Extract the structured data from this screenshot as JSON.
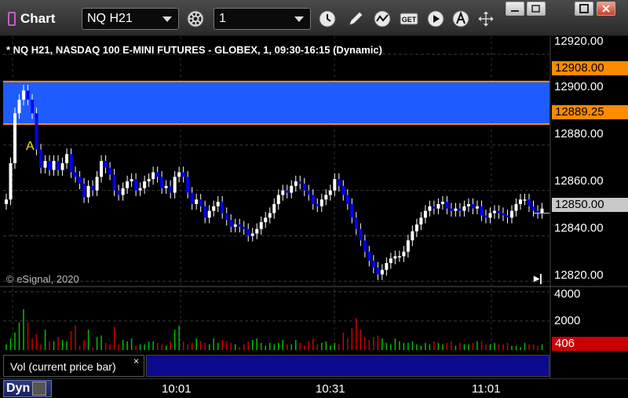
{
  "window": {
    "title": "Chart"
  },
  "toolbar": {
    "symbol": "NQ H21",
    "interval": "1",
    "icons": [
      "settings-icon",
      "clock-icon",
      "pen-icon",
      "study-icon",
      "get-icon",
      "play-icon",
      "alert-icon",
      "cursor-icon"
    ],
    "get_label": "GET",
    "window_controls": [
      "minimize",
      "restore",
      "maximize",
      "close"
    ]
  },
  "chart": {
    "header": "* NQ H21, NASDAQ 100 E-MINI FUTURES - GLOBEX, 1, 09:30-16:15 (Dynamic)",
    "copyright": "© eSignal, 2020",
    "annotation": "A",
    "scroll_end_label": "▸|",
    "price_axis": [
      "12920.00",
      "12900.00",
      "12880.00",
      "12860.00",
      "12840.00",
      "12820.00"
    ],
    "band_upper": "12908.00",
    "band_lower": "12889.25",
    "last_price": "12850.00",
    "colors": {
      "up": "#ffffff",
      "down": "#0000ff",
      "band": "#1e5cff",
      "band_line": "#ff8a00",
      "last": "#c8c8c8"
    }
  },
  "volume": {
    "pane_label": "Vol (current price bar)",
    "close": "×",
    "axis": [
      "4000",
      "2000",
      "0"
    ],
    "last": "406",
    "last_color": "#cc0000"
  },
  "bottom": {
    "mode": "Dyn",
    "times": [
      "10:01",
      "10:31",
      "11:01"
    ]
  },
  "chart_data": {
    "type": "candlestick",
    "symbol": "NQ H21",
    "interval": "1",
    "ylim": [
      12818,
      12928
    ],
    "closes": [
      12856,
      12872,
      12894,
      12900,
      12904,
      12900,
      12894,
      12878,
      12870,
      12873,
      12869,
      12873,
      12869,
      12872,
      12876,
      12868,
      12866,
      12863,
      12857,
      12862,
      12860,
      12866,
      12873,
      12870,
      12867,
      12860,
      12858,
      12861,
      12864,
      12865,
      12860,
      12861,
      12864,
      12865,
      12868,
      12866,
      12861,
      12862,
      12859,
      12866,
      12868,
      12866,
      12859,
      12854,
      12856,
      12853,
      12848,
      12851,
      12853,
      12855,
      12850,
      12847,
      12844,
      12845,
      12844,
      12843,
      12840,
      12841,
      12843,
      12846,
      12848,
      12850,
      12854,
      12858,
      12860,
      12859,
      12862,
      12864,
      12863,
      12860,
      12858,
      12854,
      12853,
      12856,
      12858,
      12860,
      12865,
      12862,
      12858,
      12854,
      12848,
      12843,
      12838,
      12833,
      12829,
      12826,
      12823,
      12825,
      12828,
      12830,
      12831,
      12831,
      12833,
      12838,
      12842,
      12845,
      12848,
      12851,
      12853,
      12852,
      12854,
      12855,
      12852,
      12851,
      12852,
      12851,
      12853,
      12854,
      12852,
      12853,
      12849,
      12848,
      12850,
      12851,
      12850,
      12849,
      12848,
      12851,
      12854,
      12856,
      12856,
      12853,
      12851,
      12850,
      12852
    ],
    "volume": [
      400,
      800,
      1200,
      1900,
      2800,
      1900,
      800,
      1100,
      400,
      1400,
      600,
      600,
      900,
      700,
      600,
      1300,
      1700,
      300,
      700,
      1400,
      200,
      900,
      1000,
      500,
      400,
      1600,
      400,
      700,
      600,
      800,
      300,
      400,
      400,
      600,
      600,
      500,
      400,
      300,
      600,
      1400,
      1700,
      600,
      400,
      500,
      800,
      600,
      500,
      400,
      800,
      500,
      700,
      600,
      500,
      400,
      200,
      400,
      600,
      700,
      800,
      500,
      300,
      500,
      400,
      500,
      700,
      400,
      400,
      700,
      500,
      300,
      600,
      800,
      400,
      500,
      600,
      300,
      500,
      400,
      1200,
      800,
      1500,
      2200,
      1400,
      900,
      700,
      900,
      1000,
      800,
      500,
      400,
      800,
      600,
      500,
      500,
      600,
      400,
      300,
      500,
      400,
      600,
      500,
      400,
      500,
      600,
      300,
      500,
      400,
      400,
      500,
      600,
      600,
      400,
      400,
      500,
      400,
      400,
      500,
      300,
      300,
      200,
      500,
      400,
      400,
      300,
      406
    ],
    "levels": {
      "band_upper": 12908.0,
      "band_lower": 12889.25,
      "last": 12850.0
    }
  }
}
